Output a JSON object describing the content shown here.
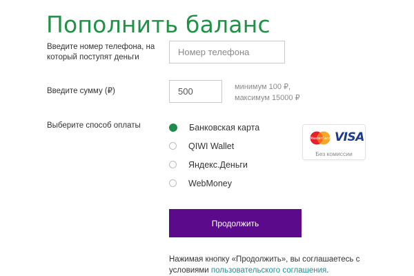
{
  "page": {
    "title": "Пополнить баланс"
  },
  "phone": {
    "label": "Введите номер телефона, на который поступят деньги",
    "placeholder": "Номер телефона",
    "value": ""
  },
  "amount": {
    "label": "Введите сумму (₽)",
    "value": "500",
    "min_text": "минимум 100 ₽,",
    "max_text": "максимум 15000 ₽"
  },
  "payment": {
    "label": "Выберите способ оплаты",
    "options": [
      {
        "label": "Банковская карта",
        "selected": true
      },
      {
        "label": "QIWI Wallet",
        "selected": false
      },
      {
        "label": "Яндекс.Деньги",
        "selected": false
      },
      {
        "label": "WebMoney",
        "selected": false
      }
    ],
    "card_badge": {
      "mastercard_text": "MasterCard",
      "visa_text": "VISA",
      "note": "Без комиссии"
    }
  },
  "actions": {
    "continue_label": "Продолжить"
  },
  "agreement": {
    "text": "Нажимая кнопку «Продолжить», вы соглашаетесь с условиями",
    "link_text": "пользовательского соглашения",
    "end": "."
  },
  "colors": {
    "title_green": "#1f9246",
    "radio_green": "#1e8c4a",
    "button_purple": "#5a0a8a",
    "link_teal": "#1e8f9b"
  }
}
